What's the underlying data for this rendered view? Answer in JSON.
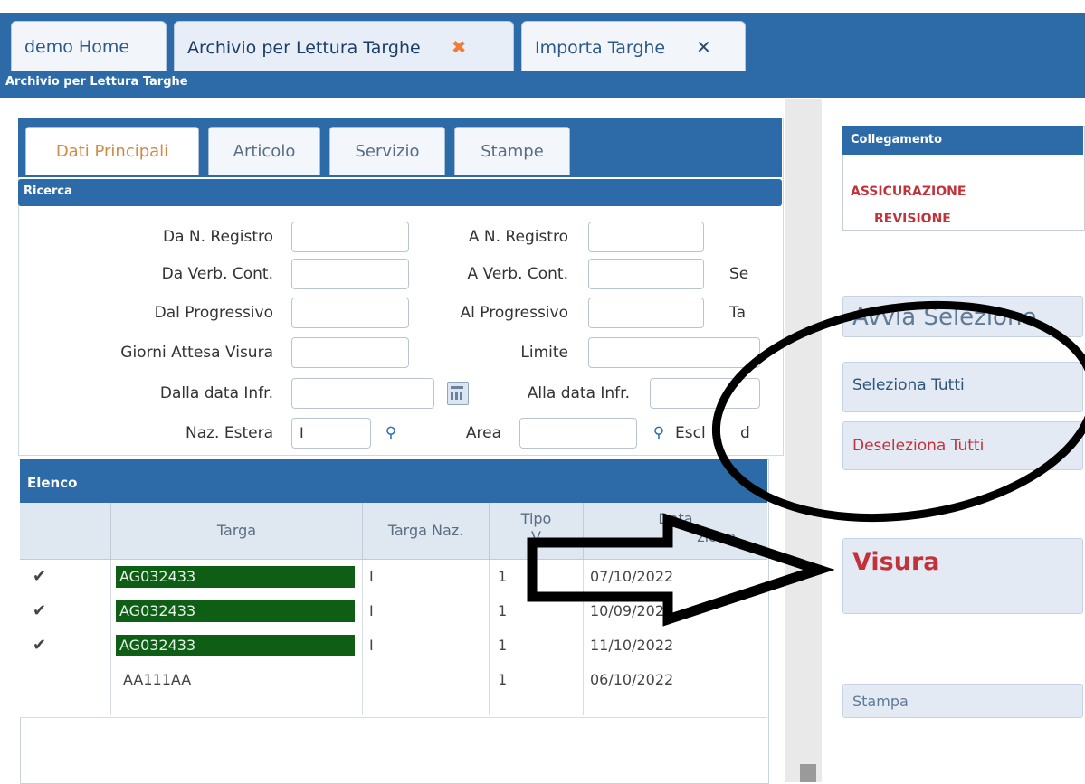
{
  "tabs": [
    {
      "label": "demo Home"
    },
    {
      "label": "Archivio per Lettura Targhe",
      "close": "✖"
    },
    {
      "label": "Importa Targhe",
      "close": "✕"
    }
  ],
  "breadcrumb": "Archivio per Lettura Targhe",
  "subtabs": [
    "Dati Principali",
    "Articolo",
    "Servizio",
    "Stampe"
  ],
  "ricerca": {
    "title": "Ricerca",
    "fields": {
      "da_n_registro": "Da N. Registro",
      "a_n_registro": "A N. Registro",
      "da_verb_cont": "Da Verb. Cont.",
      "a_verb_cont": "A Verb. Cont.",
      "se": "Se",
      "dal_progressivo": "Dal Progressivo",
      "al_progressivo": "Al Progressivo",
      "ta": "Ta",
      "giorni_attesa_visura": "Giorni Attesa Visura",
      "limite": "Limite",
      "dalla_data_infr": "Dalla data Infr.",
      "alla_data_infr": "Alla data Infr.",
      "naz_estera": "Naz. Estera",
      "naz_estera_value": "I",
      "area": "Area",
      "escl": "Escl",
      "d_suffix": "d"
    }
  },
  "elenco": {
    "title": "Elenco",
    "columns": [
      "Targa",
      "Targa Naz.",
      "Tipo",
      "V",
      "Data",
      "zione"
    ],
    "rows": [
      {
        "check": "✔",
        "targa": "AG032433",
        "naz": "I",
        "tipo": "1",
        "data": "07/10/2022",
        "selected": true
      },
      {
        "check": "✔",
        "targa": "AG032433",
        "naz": "I",
        "tipo": "1",
        "data": "10/09/202",
        "selected": true
      },
      {
        "check": "✔",
        "targa": "AG032433",
        "naz": "I",
        "tipo": "1",
        "data": "11/10/2022",
        "selected": true
      },
      {
        "check": "",
        "targa": "AA111AA",
        "naz": "",
        "tipo": "1",
        "data": "06/10/2022",
        "selected": false
      }
    ]
  },
  "collegamento": {
    "title": "Collegamento",
    "links": [
      "ASSICURAZIONE",
      "REVISIONE"
    ]
  },
  "buttons": {
    "avvia": "Avvia Selezione",
    "seleziona_tutti": "Seleziona Tutti",
    "deseleziona_tutti": "Deseleziona Tutti",
    "visura": "Visura",
    "stampa": "Stampa"
  },
  "colors": {
    "header_blue": "#2c6ba8",
    "plate_green": "#0f5e16",
    "link_red": "#c2323b"
  }
}
